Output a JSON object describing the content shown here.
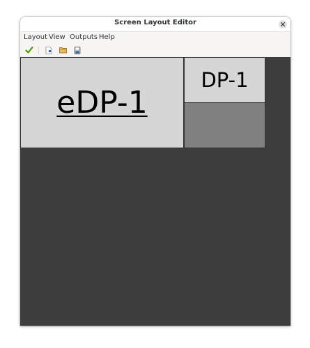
{
  "window": {
    "title": "Screen Layout Editor"
  },
  "menubar": {
    "items": [
      "Layout",
      "View",
      "Outputs",
      "Help"
    ]
  },
  "toolbar": {
    "buttons": [
      {
        "icon": "checkmark-icon",
        "color": "#4e9a06"
      },
      {
        "icon": "new-document-icon",
        "color": "#3465a4"
      },
      {
        "icon": "open-folder-icon",
        "color": "#c4a000"
      },
      {
        "icon": "save-disk-icon",
        "color": "#3465a4"
      }
    ]
  },
  "layout": {
    "outputs": [
      {
        "name": "eDP-1",
        "primary": true,
        "color": "#d6d6d6"
      },
      {
        "name": "DP-1",
        "primary": false,
        "color": "#d6d6d6"
      }
    ],
    "unassigned_area_color": "#808080",
    "background_color": "#3d3d3d"
  }
}
